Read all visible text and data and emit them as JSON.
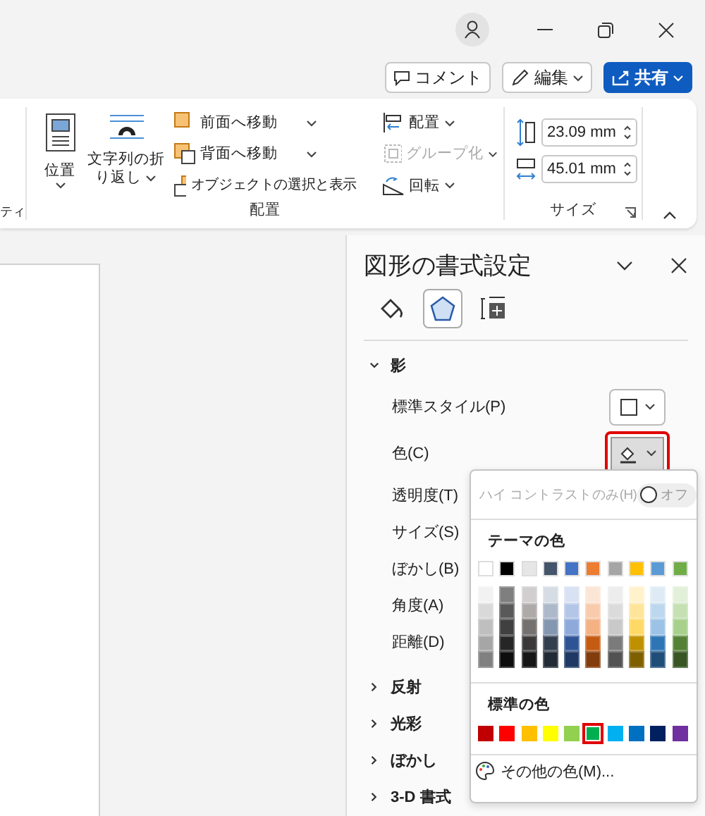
{
  "header_buttons": [
    {
      "kind": "comment",
      "label": "コメント"
    },
    {
      "kind": "edit",
      "label": "編集"
    },
    {
      "kind": "share",
      "label": "共有"
    }
  ],
  "ribbon": {
    "partial_label": "ティ",
    "arrange": {
      "label": "配置",
      "position": "位置",
      "wrap_text": [
        "文字列の折",
        "り返し"
      ],
      "bring_forward": "前面へ移動",
      "send_backward": "背面へ移動",
      "selection_pane": "オブジェクトの選択と表示",
      "align": "配置",
      "group": {
        "label": "グループ化",
        "disabled": true
      },
      "rotate": "回転"
    },
    "size": {
      "label": "サイズ",
      "height": "23.09 mm",
      "width": "45.01 mm"
    }
  },
  "pane": {
    "title": "図形の書式設定",
    "tabs": [
      {
        "kind": "fill",
        "selected": false
      },
      {
        "kind": "effects",
        "selected": true
      },
      {
        "kind": "layout",
        "selected": false
      }
    ],
    "sections": [
      {
        "label": "影",
        "expanded": true,
        "rows": [
          {
            "label": "標準スタイル(P)",
            "kind": "style"
          },
          {
            "label": "色(C)",
            "kind": "color",
            "highlighted": true
          },
          {
            "label": "透明度(T)",
            "kind": "plain"
          },
          {
            "label": "サイズ(S)",
            "kind": "plain"
          },
          {
            "label": "ぼかし(B)",
            "kind": "plain"
          },
          {
            "label": "角度(A)",
            "kind": "plain"
          },
          {
            "label": "距離(D)",
            "kind": "plain"
          }
        ]
      },
      {
        "label": "反射",
        "expanded": false
      },
      {
        "label": "光彩",
        "expanded": false
      },
      {
        "label": "ぼかし",
        "expanded": false
      },
      {
        "label": "3-D 書式",
        "expanded": false
      }
    ]
  },
  "color_menu": {
    "high_contrast": {
      "label": "ハイ コントラストのみ(H)",
      "state": "オフ",
      "on": false,
      "disabled": true
    },
    "theme_heading": "テーマの色",
    "theme_colors": [
      {
        "color": "#ffffff",
        "shades": [
          {
            "color": "#f2f2f2"
          },
          {
            "color": "#d9d9d9"
          },
          {
            "color": "#bfbfbf"
          },
          {
            "color": "#a6a6a6"
          },
          {
            "color": "#808080"
          }
        ]
      },
      {
        "color": "#000000",
        "shades": [
          {
            "color": "#7f7f7f"
          },
          {
            "color": "#595959"
          },
          {
            "color": "#404040"
          },
          {
            "color": "#262626"
          },
          {
            "color": "#0d0d0d"
          }
        ]
      },
      {
        "color": "#e7e6e6",
        "shades": [
          {
            "color": "#d0cece"
          },
          {
            "color": "#aeaaaa"
          },
          {
            "color": "#757171"
          },
          {
            "color": "#3a3838"
          },
          {
            "color": "#171616"
          }
        ]
      },
      {
        "color": "#44546a",
        "shades": [
          {
            "color": "#d6dce4"
          },
          {
            "color": "#adb9ca"
          },
          {
            "color": "#8497b0"
          },
          {
            "color": "#333f4f"
          },
          {
            "color": "#222a35"
          }
        ]
      },
      {
        "color": "#4472c4",
        "shades": [
          {
            "color": "#d9e2f3"
          },
          {
            "color": "#b4c6e7"
          },
          {
            "color": "#8eaadb"
          },
          {
            "color": "#2f5496"
          },
          {
            "color": "#1f3864"
          }
        ]
      },
      {
        "color": "#ed7d31",
        "shades": [
          {
            "color": "#fbe5d5"
          },
          {
            "color": "#f7cbac"
          },
          {
            "color": "#f4b183"
          },
          {
            "color": "#c55a11"
          },
          {
            "color": "#833c0b"
          }
        ]
      },
      {
        "color": "#a5a5a5",
        "shades": [
          {
            "color": "#ededed"
          },
          {
            "color": "#dbdbdb"
          },
          {
            "color": "#c9c9c9"
          },
          {
            "color": "#7b7b7b"
          },
          {
            "color": "#525252"
          }
        ]
      },
      {
        "color": "#ffc000",
        "shades": [
          {
            "color": "#fff2cc"
          },
          {
            "color": "#fee599"
          },
          {
            "color": "#ffd965"
          },
          {
            "color": "#bf9000"
          },
          {
            "color": "#7f6000"
          }
        ]
      },
      {
        "color": "#5b9bd5",
        "shades": [
          {
            "color": "#deebf6"
          },
          {
            "color": "#bdd7ee"
          },
          {
            "color": "#9cc3e5"
          },
          {
            "color": "#2e75b5"
          },
          {
            "color": "#1f4e79"
          }
        ]
      },
      {
        "color": "#70ad47",
        "shades": [
          {
            "color": "#e2efd9"
          },
          {
            "color": "#c5e0b3"
          },
          {
            "color": "#a8d08d"
          },
          {
            "color": "#538135"
          },
          {
            "color": "#375623"
          }
        ]
      }
    ],
    "standard_heading": "標準の色",
    "standard_colors": [
      {
        "color": "#c00000",
        "selected": false
      },
      {
        "color": "#ff0000",
        "selected": false
      },
      {
        "color": "#ffc000",
        "selected": false
      },
      {
        "color": "#ffff00",
        "selected": false
      },
      {
        "color": "#92d050",
        "selected": false
      },
      {
        "color": "#00b050",
        "selected": true
      },
      {
        "color": "#00b0f0",
        "selected": false
      },
      {
        "color": "#0070c0",
        "selected": false
      },
      {
        "color": "#002060",
        "selected": false
      },
      {
        "color": "#7030a0",
        "selected": false
      }
    ],
    "more_colors": "その他の色(M)..."
  }
}
